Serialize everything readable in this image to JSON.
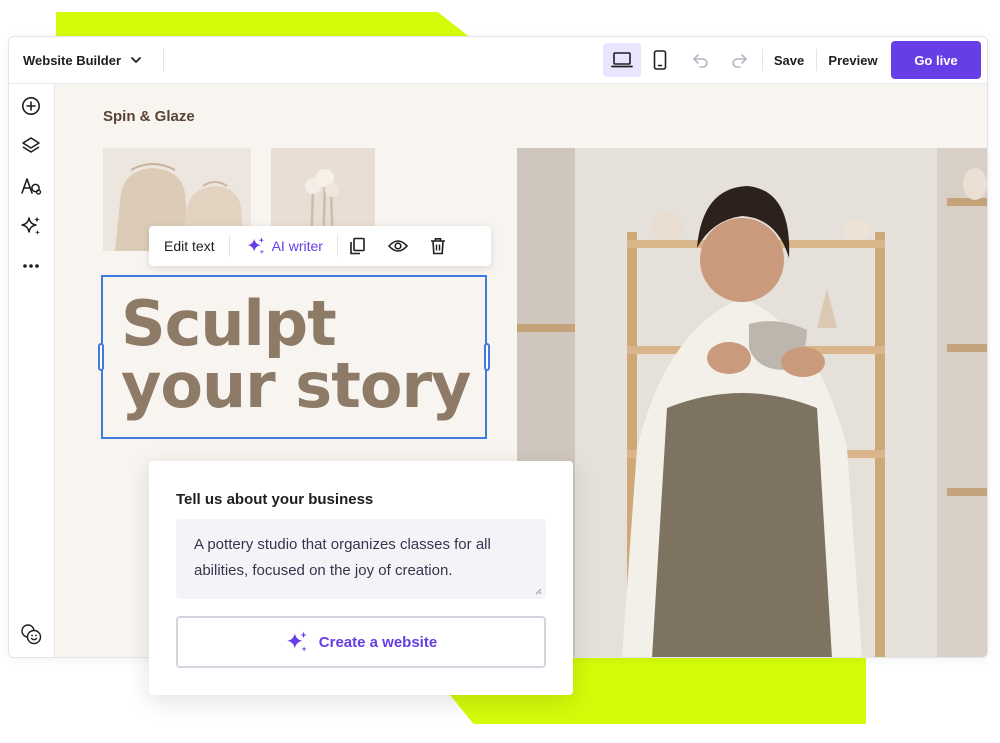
{
  "app": {
    "title": "Website Builder"
  },
  "toolbar": {
    "save_label": "Save",
    "preview_label": "Preview",
    "go_live_label": "Go live",
    "device_icons": [
      "desktop-icon",
      "mobile-icon"
    ],
    "history_icons": [
      "undo-icon",
      "redo-icon"
    ]
  },
  "sidebar": {
    "items": [
      {
        "icon": "add-icon"
      },
      {
        "icon": "layers-icon"
      },
      {
        "icon": "typography-icon"
      },
      {
        "icon": "ai-sparkle-icon"
      },
      {
        "icon": "more-icon"
      }
    ],
    "footer_icon": "emoji-icon"
  },
  "site": {
    "brand": "Spin & Glaze",
    "heading_line1": "Sculpt",
    "heading_line2": "your story"
  },
  "edit_toolbar": {
    "edit_text": "Edit text",
    "ai_writer": "AI writer",
    "icons": [
      "duplicate-icon",
      "eye-icon",
      "trash-icon"
    ]
  },
  "business_card": {
    "title": "Tell us about your business",
    "description": "A pottery studio that organizes classes for all abilities, focused on the joy of creation.",
    "button_label": "Create a website"
  },
  "colors": {
    "accent_lime": "#d4fb0a",
    "primary_purple": "#673de6",
    "heading_brown": "#8d7a67",
    "selection_blue": "#3f7ae0",
    "canvas_bg": "#f8f4f0"
  }
}
